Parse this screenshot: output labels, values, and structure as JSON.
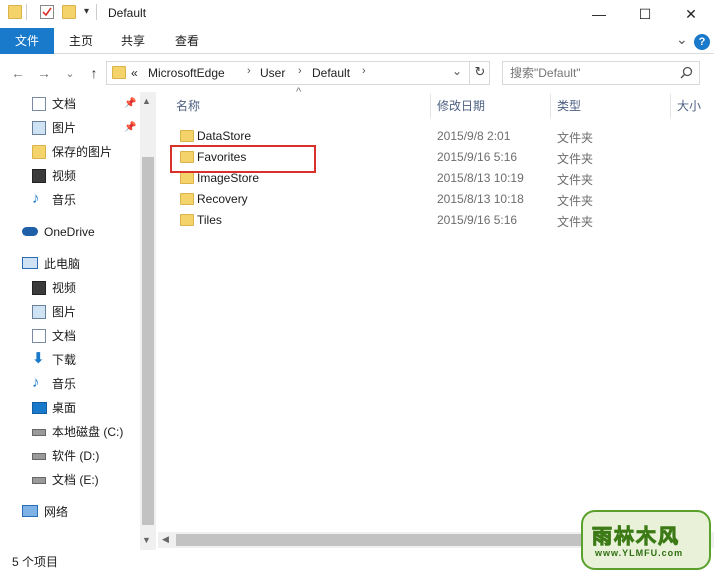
{
  "window": {
    "title": "Default",
    "minimize": "—",
    "maximize": "☐",
    "close": "✕"
  },
  "ribbon": {
    "tabs": [
      "文件",
      "主页",
      "共享",
      "查看"
    ],
    "expand": "⌄",
    "help": "?"
  },
  "address": {
    "back": "←",
    "forward": "→",
    "recent": "⌄",
    "up": "↑",
    "overflow": "«",
    "crumbs": [
      "MicrosoftEdge",
      "User",
      "Default"
    ],
    "separator": "›",
    "dropdown": "⌄",
    "refresh": "↻"
  },
  "search": {
    "placeholder": "搜索\"Default\"",
    "icon": "search-icon"
  },
  "nav": {
    "quick_access": [
      {
        "label": "文档",
        "icon": "document-icon",
        "pinned": true
      },
      {
        "label": "图片",
        "icon": "picture-icon",
        "pinned": true
      },
      {
        "label": "保存的图片",
        "icon": "folder-icon",
        "pinned": false
      },
      {
        "label": "视频",
        "icon": "video-icon",
        "pinned": false
      },
      {
        "label": "音乐",
        "icon": "music-icon",
        "pinned": false
      }
    ],
    "onedrive": "OneDrive",
    "this_pc": "此电脑",
    "pc_items": [
      {
        "label": "视频",
        "icon": "video-icon"
      },
      {
        "label": "图片",
        "icon": "picture-icon"
      },
      {
        "label": "文档",
        "icon": "document-icon"
      },
      {
        "label": "下载",
        "icon": "download-icon"
      },
      {
        "label": "音乐",
        "icon": "music-icon"
      },
      {
        "label": "桌面",
        "icon": "desktop-icon"
      },
      {
        "label": "本地磁盘 (C:)",
        "icon": "drive-icon"
      },
      {
        "label": "软件 (D:)",
        "icon": "drive-icon"
      },
      {
        "label": "文档 (E:)",
        "icon": "drive-icon"
      }
    ],
    "network": "网络"
  },
  "columns": {
    "sort_arrow": "^",
    "name": "名称",
    "date": "修改日期",
    "type": "类型",
    "size": "大小"
  },
  "files": [
    {
      "name": "DataStore",
      "date": "2015/9/8 2:01",
      "type": "文件夹"
    },
    {
      "name": "Favorites",
      "date": "2015/9/16 5:16",
      "type": "文件夹"
    },
    {
      "name": "ImageStore",
      "date": "2015/8/13 10:19",
      "type": "文件夹"
    },
    {
      "name": "Recovery",
      "date": "2015/8/13 10:18",
      "type": "文件夹"
    },
    {
      "name": "Tiles",
      "date": "2015/9/16 5:16",
      "type": "文件夹"
    }
  ],
  "status": {
    "item_count": "5 个项目"
  },
  "watermark": {
    "text": "雨林木风",
    "url": "www.YLMFU.com"
  },
  "colors": {
    "accent": "#1979ca",
    "folder": "#f5d36b",
    "highlight": "#d9302c"
  }
}
